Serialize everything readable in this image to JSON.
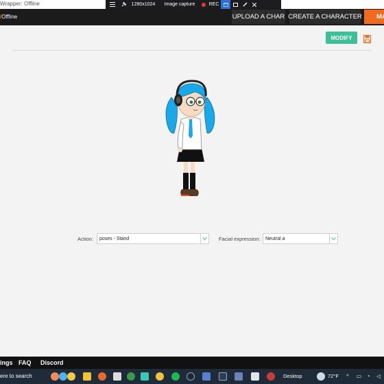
{
  "browser": {
    "title": "Wrapper: Offline"
  },
  "capture_toolbar": {
    "resolution": "1280x1024",
    "mode": "Image capture",
    "rec": "REC"
  },
  "header": {
    "logo_text": "Offline",
    "upload_label": "UPLOAD A CHAR",
    "create_label": "CREATE A CHARACTER",
    "truncated_label": "MA"
  },
  "editor": {
    "modify_label": "MODIFY"
  },
  "form": {
    "action_label": "Action:",
    "action_value": "poses - Stand",
    "facial_label": "Facial expression:",
    "facial_value": "Neutral a"
  },
  "footer": {
    "links": [
      "ings",
      "FAQ",
      "Discord"
    ]
  },
  "taskbar": {
    "search_text": "ere to search",
    "desktop_label": "Desktop",
    "temperature": "72°F"
  },
  "colors": {
    "accent": "#f06a1f",
    "modify": "#3fbf97",
    "hair": "#1aa8e8",
    "header": "#1b1b1b"
  }
}
